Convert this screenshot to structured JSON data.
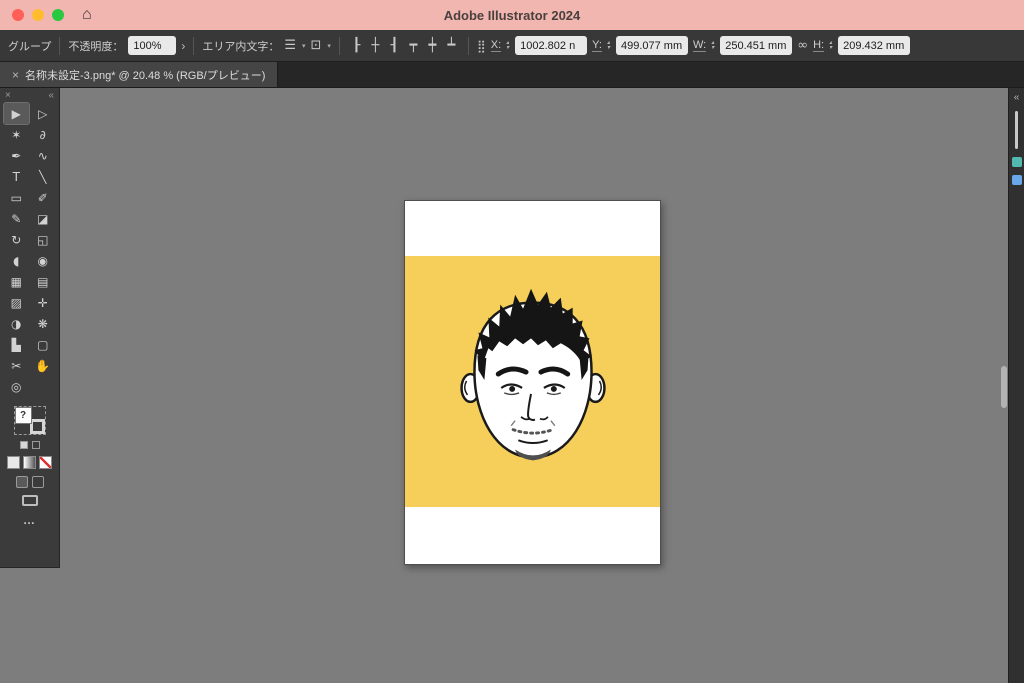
{
  "colors": {
    "titlebar_bg": "#f2b6b1",
    "traffic_red": "#ff5f57",
    "traffic_yellow": "#febc2e",
    "traffic_green": "#28c840",
    "panel_bg": "#3b3b3b",
    "canvas_bg": "#7d7d7d",
    "artboard_yellow": "#f5cf5a",
    "ink": "#1a1a1a",
    "beard_gray": "#4f4f4f"
  },
  "titlebar": {
    "title": "Adobe Illustrator 2024",
    "home_icon": "⌂"
  },
  "control_bar": {
    "selection_label": "グループ",
    "opacity_label": "不透明度：",
    "opacity_value": "100%",
    "opacity_expand": "›",
    "area_type_label": "エリア内文字：",
    "area_type_icon": "☰",
    "flow_icon": "⊡",
    "dropdown_glyph": "▾",
    "reference_grid_icon": "⣿",
    "link_icon": "∞",
    "stepper_up": "▴",
    "stepper_down": "▾",
    "align_icons": [
      {
        "name": "align-left-icon",
        "glyph": "┠"
      },
      {
        "name": "align-center-icon",
        "glyph": "┼"
      },
      {
        "name": "align-right-icon",
        "glyph": "┨"
      },
      {
        "name": "align-top-icon",
        "glyph": "┯"
      },
      {
        "name": "align-middle-icon",
        "glyph": "┿"
      },
      {
        "name": "align-bottom-icon",
        "glyph": "┷"
      }
    ],
    "fields": {
      "x": {
        "label": "X:",
        "value": "1002.802 n"
      },
      "y": {
        "label": "Y:",
        "value": "499.077 mm"
      },
      "w": {
        "label": "W:",
        "value": "250.451 mm"
      },
      "h": {
        "label": "H:",
        "value": "209.432 mm"
      }
    }
  },
  "document_tab": {
    "close_icon": "×",
    "title": "名称未設定-3.png* @ 20.48 % (RGB/プレビュー)"
  },
  "toolbar": {
    "close_icon": "×",
    "collapse_icon": "«",
    "tools": [
      {
        "name": "selection-tool",
        "glyph": "▶",
        "selected": true
      },
      {
        "name": "direct-selection-tool",
        "glyph": "▷"
      },
      {
        "name": "magic-wand-tool",
        "glyph": "✶"
      },
      {
        "name": "lasso-tool",
        "glyph": "∂"
      },
      {
        "name": "pen-tool",
        "glyph": "✒"
      },
      {
        "name": "curvature-tool",
        "glyph": "∿"
      },
      {
        "name": "type-tool",
        "glyph": "T"
      },
      {
        "name": "line-segment-tool",
        "glyph": "╲"
      },
      {
        "name": "rectangle-tool",
        "glyph": "▭"
      },
      {
        "name": "paintbrush-tool",
        "glyph": "✐"
      },
      {
        "name": "pencil-tool",
        "glyph": "✎"
      },
      {
        "name": "eraser-tool",
        "glyph": "◪"
      },
      {
        "name": "rotate-tool",
        "glyph": "↻"
      },
      {
        "name": "scale-tool",
        "glyph": "◱"
      },
      {
        "name": "width-tool",
        "glyph": "◖"
      },
      {
        "name": "shape-builder-tool",
        "glyph": "◉"
      },
      {
        "name": "perspective-grid-tool",
        "glyph": "▦"
      },
      {
        "name": "mesh-tool",
        "glyph": "▤"
      },
      {
        "name": "gradient-tool",
        "glyph": "▨"
      },
      {
        "name": "eyedropper-tool",
        "glyph": "✛"
      },
      {
        "name": "blend-tool",
        "glyph": "◑"
      },
      {
        "name": "symbol-sprayer-tool",
        "glyph": "❋"
      },
      {
        "name": "column-graph-tool",
        "glyph": "▙"
      },
      {
        "name": "artboard-tool",
        "glyph": "▢"
      },
      {
        "name": "slice-tool",
        "glyph": "✂"
      },
      {
        "name": "hand-tool",
        "glyph": "✋"
      },
      {
        "name": "zoom-tool",
        "glyph": "◎"
      }
    ],
    "footer": {
      "help_glyph": "?",
      "more_glyph": "…"
    }
  },
  "right_dock": {
    "collapse_icon": "«"
  }
}
